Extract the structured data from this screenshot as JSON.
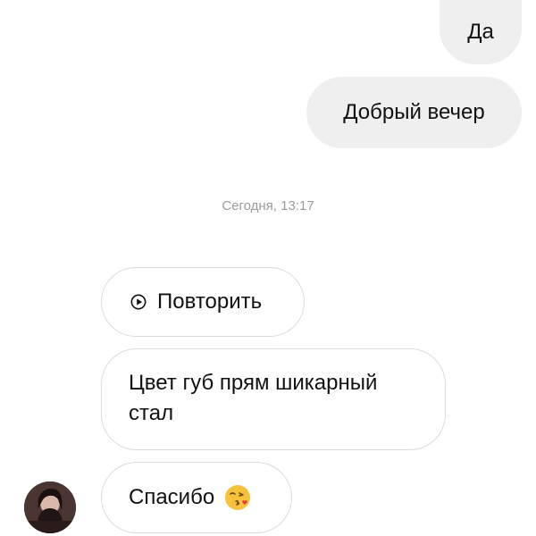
{
  "messages": {
    "sent_1": "Да",
    "sent_2": "Добрый вечер",
    "timestamp": "Сегодня, 13:17",
    "replay_label": "Повторить",
    "received_1": "Цвет губ прям шикарный стал",
    "received_2": "Спасибо"
  },
  "icons": {
    "replay": "play-circle-icon",
    "emoji": "face-blowing-kiss-emoji",
    "avatar": "contact-avatar"
  },
  "colors": {
    "sent_bubble": "#efefef",
    "received_border": "#dbdbdb",
    "timestamp": "#9b9b9b",
    "text": "#111111"
  }
}
